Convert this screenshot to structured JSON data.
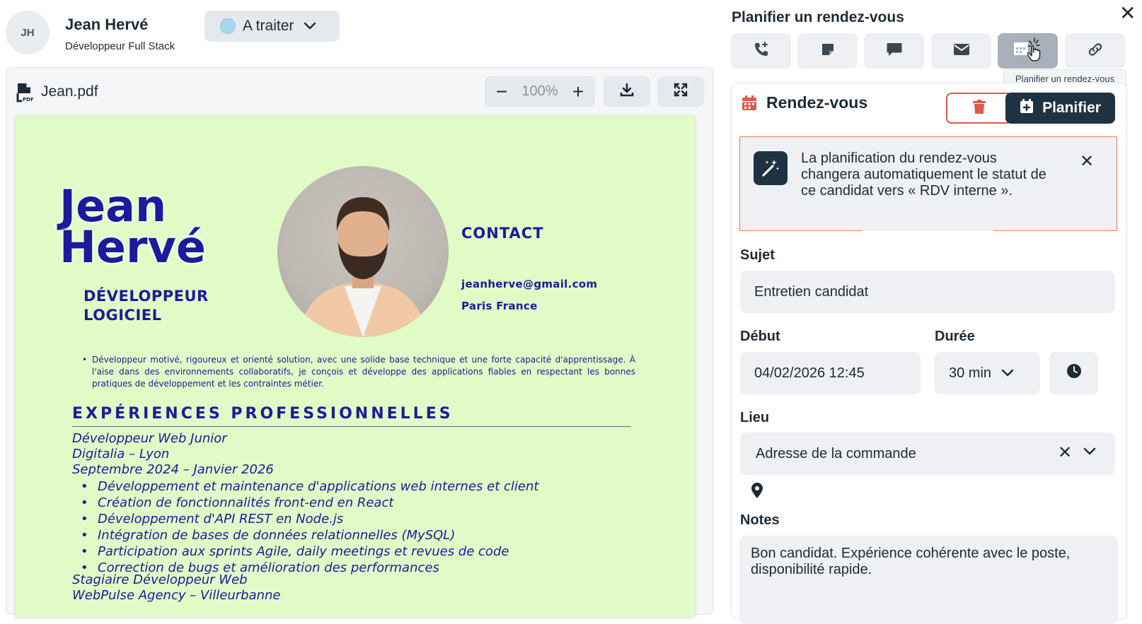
{
  "candidate": {
    "initials": "JH",
    "name": "Jean Hervé",
    "role": "Développeur Full Stack",
    "status": "A traiter",
    "status_color": "#a8d8ef"
  },
  "viewer": {
    "file_name": "Jean.pdf",
    "zoom": "100%",
    "zoom_out": "−",
    "zoom_in": "+",
    "icons": [
      "pdf-file-icon",
      "download-icon",
      "fullscreen-icon"
    ]
  },
  "cv": {
    "name_line1": "Jean",
    "name_line2": "Hervé",
    "title_line1": "DÉVELOPPEUR",
    "title_line2": "LOGICIEL",
    "contact_heading": "CONTACT",
    "email": "jeanherve@gmail.com",
    "city": "Paris France",
    "summary": "Développeur motivé, rigoureux et orienté solution, avec une solide base technique et une forte capacité d'apprentissage. À l'aise dans des environnements collaboratifs, je conçois et développe des applications fiables en respectant les bonnes pratiques de développement et les contraintes métier.",
    "experience_heading": "EXPÉRIENCES PROFESSIONNELLES",
    "job1_title": "Développeur Web Junior",
    "job1_company": "Digitalia – Lyon",
    "job1_dates": "Septembre 2024 – Janvier 2026",
    "job1_bullets": [
      "Développement et maintenance d'applications web internes et client",
      "Création de fonctionnalités front-end en React",
      "Développement d'API REST en Node.js",
      "Intégration de bases de données relationnelles (MySQL)",
      "Participation aux sprints Agile, daily meetings et revues de code",
      "Correction de bugs et amélioration des performances"
    ],
    "job2_title": "Stagiaire Développeur Web",
    "job2_company": "WebPulse Agency – Villeurbanne"
  },
  "panel": {
    "title": "Planifier un rendez-vous",
    "close": "✕",
    "actions": [
      "phone-add-icon",
      "note-icon",
      "chat-icon",
      "mail-icon",
      "calendar-icon",
      "link-icon"
    ],
    "tooltip": "Planifier un rendez-vous",
    "card_title": "Rendez-vous",
    "plan_label": "Planifier",
    "alert_text": "La planification du rendez-vous changera automatiquement le statut de ce candidat vers « RDV interne ».",
    "alert_close": "✕",
    "subject_label": "Sujet",
    "subject_value": "Entretien candidat",
    "start_label": "Début",
    "start_value": "04/02/2026 12:45",
    "duration_label": "Durée",
    "duration_value": "30 min",
    "place_label": "Lieu",
    "place_value": "Adresse de la commande",
    "place_clear": "✕",
    "notes_label": "Notes",
    "notes_value": "Bon candidat. Expérience cohérente avec le poste, disponibilité rapide."
  },
  "colors": {
    "primary_dark": "#1f3242",
    "danger": "#e2574c",
    "alert_border": "#f07c48",
    "cv_background": "#e1fbc6",
    "cv_ink": "#1d1a9c"
  }
}
